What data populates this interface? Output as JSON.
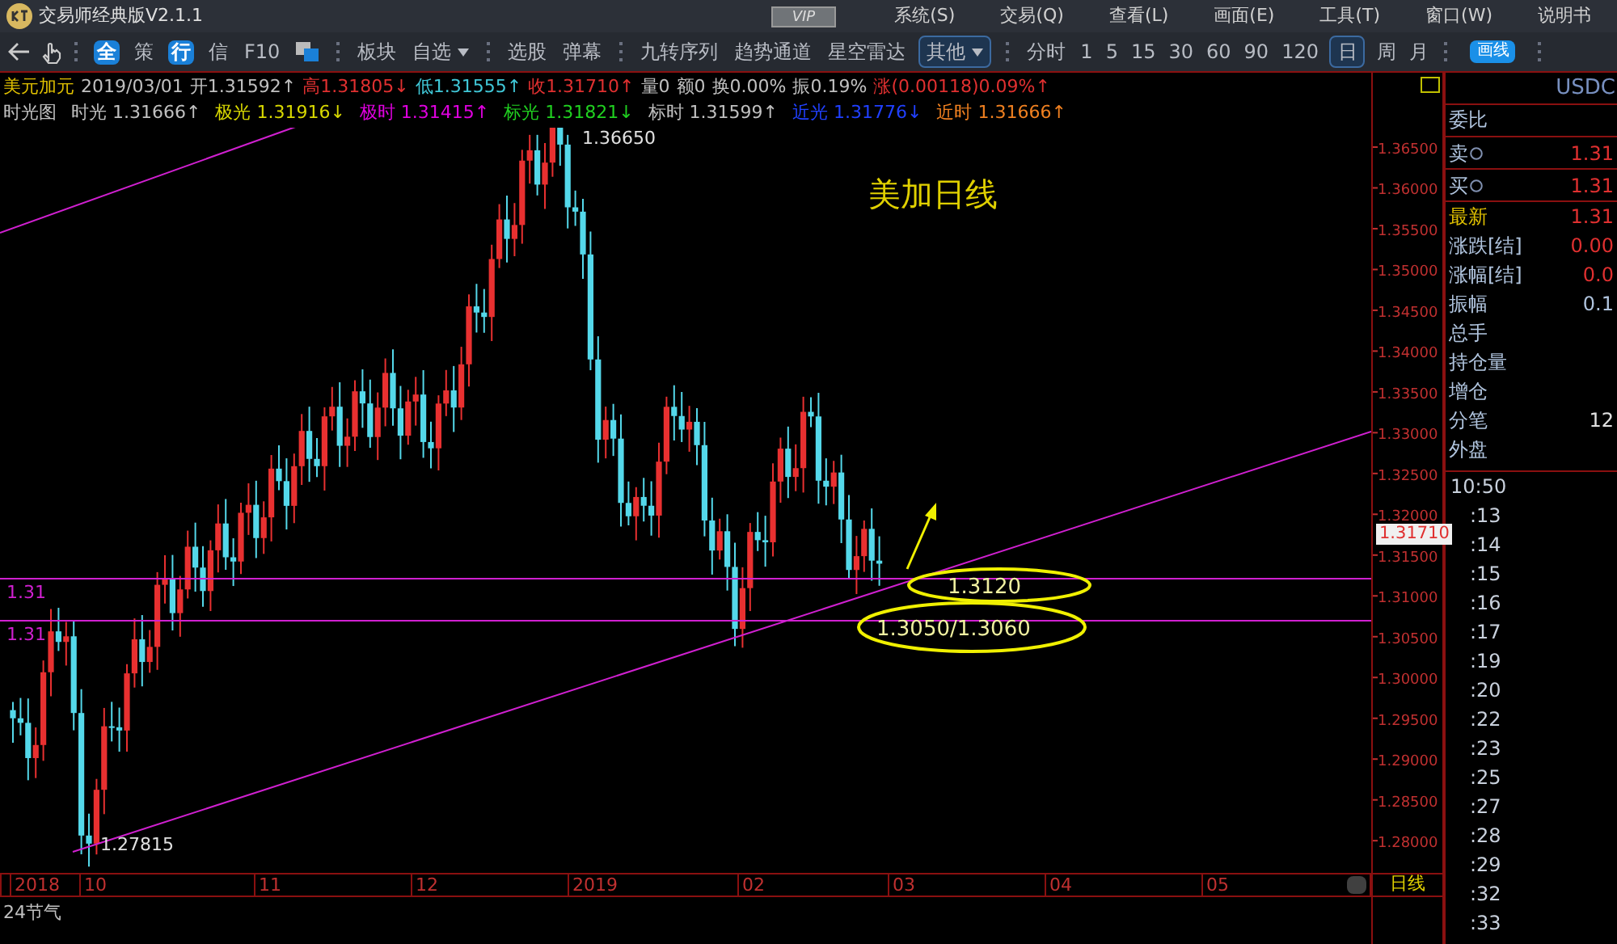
{
  "title_bar": {
    "app_name": "交易师经典版V2.1.1",
    "vip": "VIP",
    "menu": [
      "系统(S)",
      "交易(Q)",
      "查看(L)",
      "画面(E)",
      "工具(T)",
      "窗口(W)",
      "说明书"
    ]
  },
  "toolbar": {
    "items": [
      {
        "label": "全",
        "kind": "badge"
      },
      {
        "label": "策",
        "kind": "text"
      },
      {
        "label": "行",
        "kind": "badge"
      },
      {
        "label": "信",
        "kind": "text"
      },
      {
        "label": "F10",
        "kind": "text"
      },
      {
        "kind": "windows"
      },
      {
        "kind": "sep"
      },
      {
        "label": "板块",
        "kind": "text"
      },
      {
        "label": "自选",
        "kind": "caret"
      },
      {
        "kind": "sep"
      },
      {
        "label": "选股",
        "kind": "text"
      },
      {
        "label": "弹幕",
        "kind": "text"
      },
      {
        "kind": "sep"
      },
      {
        "label": "九转序列",
        "kind": "text"
      },
      {
        "label": "趋势通道",
        "kind": "text"
      },
      {
        "label": "星空雷达",
        "kind": "text"
      },
      {
        "label": "其他",
        "kind": "dropdown"
      },
      {
        "kind": "sep"
      },
      {
        "label": "分时",
        "kind": "text"
      }
    ],
    "periods": [
      {
        "label": "1",
        "selected": false
      },
      {
        "label": "5",
        "selected": false
      },
      {
        "label": "15",
        "selected": false
      },
      {
        "label": "30",
        "selected": false
      },
      {
        "label": "60",
        "selected": false
      },
      {
        "label": "90",
        "selected": false
      },
      {
        "label": "120",
        "selected": false
      },
      {
        "label": "日",
        "selected": true
      },
      {
        "label": "周",
        "selected": false
      },
      {
        "label": "月",
        "selected": false
      }
    ],
    "draw_button": "画线"
  },
  "quote_line": [
    {
      "text": "美元加元",
      "color": "#e0c000"
    },
    {
      "text": "2019/03/01",
      "color": "#c0c0c0"
    },
    {
      "text": "开1.31592↑",
      "color": "#c0c0c0"
    },
    {
      "text": "高1.31805↓",
      "color": "#e03030"
    },
    {
      "text": "低1.31555↑",
      "color": "#40c8d8"
    },
    {
      "text": "收1.31710↑",
      "color": "#e03030"
    },
    {
      "text": "量0",
      "color": "#c0c0c0"
    },
    {
      "text": "额0",
      "color": "#c0c0c0"
    },
    {
      "text": "换0.00%",
      "color": "#c0c0c0"
    },
    {
      "text": "振0.19%",
      "color": "#c0c0c0"
    },
    {
      "text": "涨(0.00118)0.09%↑",
      "color": "#e03030"
    }
  ],
  "indicator_line": [
    {
      "text": "时光图",
      "color": "#c0c0c0"
    },
    {
      "text": "时光 1.31666↑",
      "color": "#c0c0c0"
    },
    {
      "text": "极光 1.31916↓",
      "color": "#d8d800"
    },
    {
      "text": "极时 1.31415↑",
      "color": "#e000e0"
    },
    {
      "text": "标光 1.31821↓",
      "color": "#20d020"
    },
    {
      "text": "标时 1.31599↑",
      "color": "#c0c0c0"
    },
    {
      "text": "近光 1.31776↓",
      "color": "#2040ff"
    },
    {
      "text": "近时 1.31666↑",
      "color": "#f08020"
    }
  ],
  "chart": {
    "title": "美加日线",
    "high_label": "1.36650",
    "low_label": "1.27815",
    "level_labels": [
      "1.31",
      "1.31"
    ],
    "targets": [
      "1.3120",
      "1.3050/1.3060"
    ],
    "price_ticks": [
      "1.36500",
      "1.36000",
      "1.35500",
      "1.35000",
      "1.34500",
      "1.34000",
      "1.33500",
      "1.33000",
      "1.32500",
      "1.32000",
      "1.31500",
      "1.31000",
      "1.30500",
      "1.30000",
      "1.29500",
      "1.29000",
      "1.28500",
      "1.28000"
    ],
    "last_price": "1.31710",
    "time_labels": [
      "2018",
      "10",
      "11",
      "12",
      "2019",
      "02",
      "03",
      "04",
      "05"
    ],
    "period_label": "日线",
    "bottom_label": "24节气"
  },
  "side_panel": {
    "symbol": "USDC",
    "ratio_label": "委比",
    "order_rows": [
      {
        "label": "卖",
        "value": "1.31"
      },
      {
        "label": "买",
        "value": "1.31"
      }
    ],
    "stats": [
      {
        "label": "最新",
        "value": "1.31",
        "color": "#e0c000"
      },
      {
        "label": "涨跌[结]",
        "value": "0.00",
        "color": "#b0c4de"
      },
      {
        "label": "涨幅[结]",
        "value": "0.0",
        "color": "#b0c4de"
      },
      {
        "label": "振幅",
        "value": "0.1",
        "color": "#b0c4de"
      },
      {
        "label": "总手",
        "color": "#b0c4de"
      },
      {
        "label": "持仓量",
        "color": "#b0c4de"
      },
      {
        "label": "增仓",
        "color": "#b0c4de"
      },
      {
        "label": "分笔",
        "value": "12",
        "color": "#b0c4de"
      },
      {
        "label": "外盘",
        "color": "#b0c4de"
      }
    ],
    "times": [
      "10:50",
      ":13",
      ":14",
      ":15",
      ":16",
      ":17",
      ":19",
      ":20",
      ":22",
      ":23",
      ":25",
      ":27",
      ":28",
      ":29",
      ":32",
      ":33"
    ]
  }
}
